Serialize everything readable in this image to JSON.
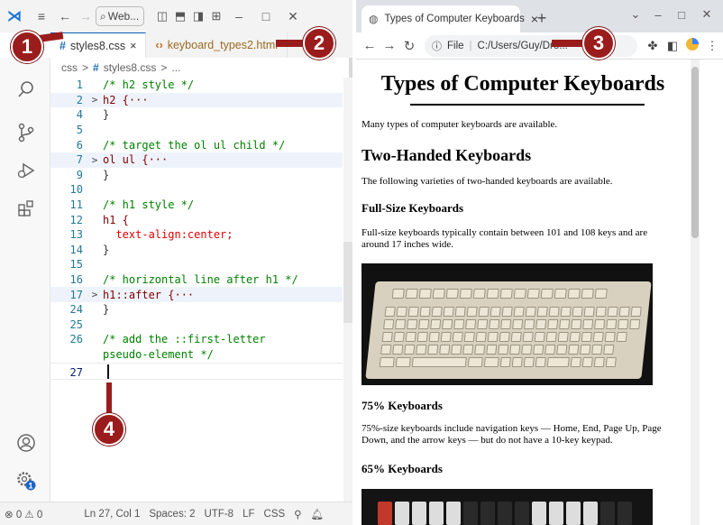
{
  "vscode": {
    "search_label": "Web...",
    "tabs": [
      {
        "label": "styles8.css",
        "close": "×"
      },
      {
        "label": "keyboard_types2.html"
      }
    ],
    "breadcrumb": {
      "root": "css",
      "sep": ">",
      "file": "styles8.css",
      "tail": "..."
    },
    "lines": [
      {
        "n": "1",
        "fold": "",
        "code": "/* h2 style */",
        "kind": "comment"
      },
      {
        "n": "2",
        "fold": ">",
        "code": "h2 {···",
        "kind": "selector",
        "hl": true
      },
      {
        "n": "4",
        "fold": "",
        "code": "}",
        "kind": "punct"
      },
      {
        "n": "5",
        "fold": "",
        "code": "",
        "kind": "punct"
      },
      {
        "n": "6",
        "fold": "",
        "code": "/* target the ol ul child */",
        "kind": "comment"
      },
      {
        "n": "7",
        "fold": ">",
        "code": "ol ul {···",
        "kind": "selector",
        "hl": true
      },
      {
        "n": "9",
        "fold": "",
        "code": "}",
        "kind": "punct"
      },
      {
        "n": "10",
        "fold": "",
        "code": "",
        "kind": "punct"
      },
      {
        "n": "11",
        "fold": "",
        "code": "/* h1 style */",
        "kind": "comment"
      },
      {
        "n": "12",
        "fold": "",
        "code": "h1 {",
        "kind": "selector"
      },
      {
        "n": "13",
        "fold": "",
        "code": "  text-align:center;",
        "kind": "decl"
      },
      {
        "n": "14",
        "fold": "",
        "code": "}",
        "kind": "punct"
      },
      {
        "n": "15",
        "fold": "",
        "code": "",
        "kind": "punct"
      },
      {
        "n": "16",
        "fold": "",
        "code": "/* horizontal line after h1 */",
        "kind": "comment"
      },
      {
        "n": "17",
        "fold": ">",
        "code": "h1::after {···",
        "kind": "selector",
        "hl": true
      },
      {
        "n": "24",
        "fold": "",
        "code": "}",
        "kind": "punct"
      },
      {
        "n": "25",
        "fold": "",
        "code": "",
        "kind": "punct"
      },
      {
        "n": "26",
        "fold": "",
        "code": "/* add the ::first-letter",
        "kind": "comment"
      },
      {
        "n": "",
        "fold": "",
        "code": "pseudo-element */",
        "kind": "comment"
      },
      {
        "n": "27",
        "fold": "",
        "code": "",
        "kind": "punct",
        "current": true
      }
    ],
    "status": {
      "problems": "⊗ 0 ⚠ 0",
      "position": "Ln 27, Col 1",
      "spaces": "Spaces: 2",
      "encoding": "UTF-8",
      "eol": "LF",
      "language": "CSS",
      "settings_badge": "1"
    }
  },
  "chrome": {
    "tab_title": "Types of Computer Keyboards",
    "tab_close": "×",
    "new_tab": "+",
    "url_prefix": "File",
    "url": "C:/Users/Guy/Dro...",
    "page": {
      "h1": "Types of Computer Keyboards",
      "intro": "Many types of computer keyboards are available.",
      "h2": "Two-Handed Keyboards",
      "h2_text": "The following varieties of two-handed keyboards are available.",
      "full_h": "Full-Size Keyboards",
      "full_text": "Full-size keyboards typically contain between 101 and 108 keys and are around 17 inches wide.",
      "p75_h": "75% Keyboards",
      "p75_text": "75%-size keyboards include navigation keys — Home, End, Page Up, Page Down, and the arrow keys — but do not have a 10-key keypad.",
      "p65_h": "65% Keyboards"
    }
  },
  "callouts": [
    "1",
    "2",
    "3",
    "4"
  ]
}
